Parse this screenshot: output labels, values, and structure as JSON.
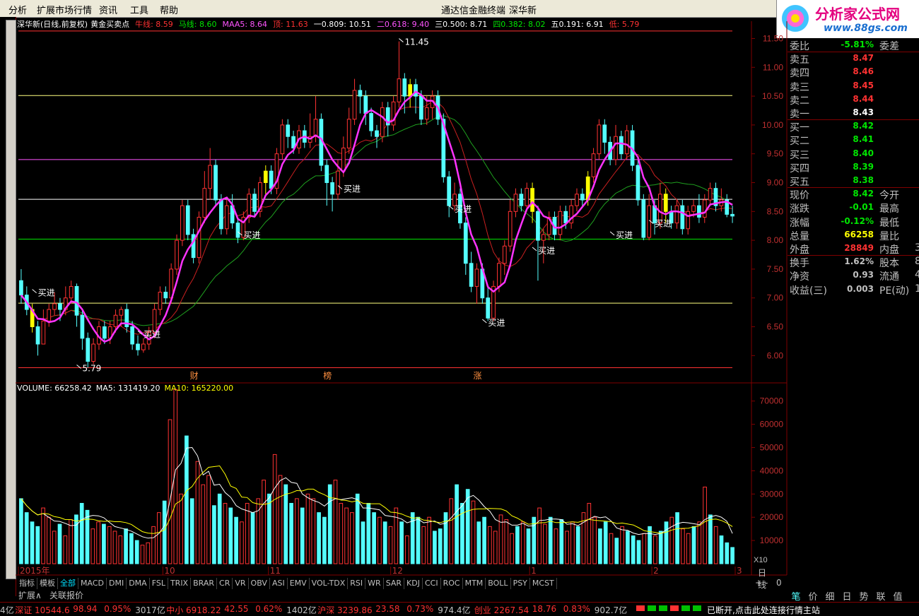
{
  "menu": {
    "items": [
      "分析",
      "扩展市场行情",
      "资讯",
      "工具",
      "帮助"
    ],
    "center_title": "通达信金融终端",
    "stock_title": "深华新"
  },
  "logo": {
    "brand": "分析家公式网",
    "url": "www.88gs.com"
  },
  "chart_header": {
    "title": "深华新(日线,前复权)",
    "indicator": "黄金买卖点",
    "items": [
      {
        "label": "牛线: 8.59",
        "color": "#ff3232"
      },
      {
        "label": "马线: 8.60",
        "color": "#00e600"
      },
      {
        "label": "MAA5: 8.64",
        "color": "#ff54ff"
      },
      {
        "label": "顶: 11.63",
        "color": "#ff3232"
      },
      {
        "label": "一0.809: 10.51",
        "color": "#ffffff"
      },
      {
        "label": "二0.618: 9.40",
        "color": "#ff54ff"
      },
      {
        "label": "三0.500: 8.71",
        "color": "#ffffff"
      },
      {
        "label": "四0.382: 8.02",
        "color": "#00e600"
      },
      {
        "label": "五0.191: 6.91",
        "color": "#ffffff"
      },
      {
        "label": "低: 5.79",
        "color": "#ff3232"
      }
    ]
  },
  "chart_data": [
    {
      "type": "candlestick",
      "title": "深华新(日线,前复权) 黄金买卖点",
      "y_ticks": [
        "11.50",
        "11.00",
        "10.50",
        "10.00",
        "9.50",
        "9.00",
        "8.50",
        "8.00",
        "7.50",
        "7.00",
        "6.50",
        "6.00"
      ],
      "ylim": [
        5.6,
        11.8
      ],
      "x_labels": [
        "2015年",
        "10",
        "11",
        "12",
        "1",
        "2",
        "3"
      ],
      "levels": [
        {
          "name": "顶",
          "value": 11.63,
          "color": "#ff3232"
        },
        {
          "name": "一0.809",
          "value": 10.51,
          "color": "#ffff80"
        },
        {
          "name": "二0.618",
          "value": 9.4,
          "color": "#ff54ff"
        },
        {
          "name": "三0.500",
          "value": 8.71,
          "color": "#ffffff"
        },
        {
          "name": "四0.382",
          "value": 8.02,
          "color": "#00e600"
        },
        {
          "name": "五0.191",
          "value": 6.91,
          "color": "#ffff80"
        },
        {
          "name": "低",
          "value": 5.79,
          "color": "#ff3232"
        }
      ],
      "annotations": [
        {
          "text": "11.45",
          "x": 68,
          "y": 11.45
        },
        {
          "text": "5.79",
          "x": 10,
          "y": 5.79
        },
        {
          "text": "买进",
          "x": 2,
          "y": 7.1
        },
        {
          "text": "买进",
          "x": 21,
          "y": 6.38
        },
        {
          "text": "买进",
          "x": 39,
          "y": 8.1
        },
        {
          "text": "买进",
          "x": 57,
          "y": 8.9
        },
        {
          "text": "买进",
          "x": 77,
          "y": 8.55
        },
        {
          "text": "买进",
          "x": 83,
          "y": 6.58
        },
        {
          "text": "买进",
          "x": 92,
          "y": 7.83
        },
        {
          "text": "买进",
          "x": 106,
          "y": 8.1
        },
        {
          "text": "买进",
          "x": 113,
          "y": 8.3
        }
      ],
      "markers": [
        {
          "text": "财",
          "x": 31
        },
        {
          "text": "榜",
          "x": 55
        },
        {
          "text": "涨",
          "x": 82
        }
      ],
      "candles": [
        [
          7.3,
          7.05,
          7.5,
          6.9
        ],
        [
          7.05,
          6.8,
          7.2,
          6.7
        ],
        [
          6.8,
          6.5,
          6.9,
          6.4
        ],
        [
          6.5,
          6.2,
          6.6,
          6.0
        ],
        [
          6.2,
          6.6,
          6.8,
          6.2
        ],
        [
          6.6,
          6.8,
          6.9,
          6.5
        ],
        [
          6.8,
          6.9,
          7.1,
          6.7
        ],
        [
          6.9,
          6.8,
          7.0,
          6.6
        ],
        [
          6.8,
          7.0,
          7.2,
          6.7
        ],
        [
          7.0,
          7.2,
          7.3,
          6.9
        ],
        [
          7.2,
          6.7,
          7.25,
          6.5
        ],
        [
          6.7,
          6.3,
          6.8,
          6.1
        ],
        [
          6.3,
          5.9,
          6.4,
          5.79
        ],
        [
          5.9,
          6.2,
          6.3,
          5.85
        ],
        [
          6.2,
          6.5,
          6.6,
          6.1
        ],
        [
          6.5,
          6.3,
          6.6,
          6.2
        ],
        [
          6.3,
          6.5,
          6.6,
          6.2
        ],
        [
          6.5,
          6.7,
          6.8,
          6.4
        ],
        [
          6.7,
          6.8,
          6.85,
          6.5
        ],
        [
          6.8,
          6.5,
          6.9,
          6.4
        ],
        [
          6.5,
          6.2,
          6.6,
          6.1
        ],
        [
          6.2,
          6.1,
          6.35,
          6.0
        ],
        [
          6.1,
          6.2,
          6.3,
          6.05
        ],
        [
          6.2,
          6.4,
          6.5,
          6.1
        ],
        [
          6.4,
          6.8,
          6.9,
          6.3
        ],
        [
          6.8,
          7.1,
          7.2,
          6.7
        ],
        [
          7.1,
          7.0,
          7.2,
          6.9
        ],
        [
          7.0,
          7.5,
          7.6,
          6.9
        ],
        [
          7.5,
          8.0,
          8.1,
          7.4
        ],
        [
          8.0,
          8.6,
          8.7,
          7.9
        ],
        [
          8.6,
          8.1,
          8.7,
          8.0
        ],
        [
          8.1,
          7.7,
          8.2,
          7.6
        ],
        [
          7.7,
          8.4,
          8.5,
          7.6
        ],
        [
          8.4,
          8.9,
          9.2,
          8.3
        ],
        [
          8.9,
          9.3,
          9.6,
          8.7
        ],
        [
          9.3,
          8.7,
          9.4,
          8.6
        ],
        [
          8.7,
          8.2,
          8.8,
          8.1
        ],
        [
          8.2,
          8.6,
          8.7,
          8.1
        ],
        [
          8.6,
          8.3,
          8.8,
          8.2
        ],
        [
          8.3,
          8.05,
          8.4,
          7.95
        ],
        [
          8.05,
          8.4,
          8.5,
          8.0
        ],
        [
          8.4,
          8.8,
          8.9,
          8.3
        ],
        [
          8.8,
          8.5,
          8.9,
          8.4
        ],
        [
          8.5,
          9.0,
          9.1,
          8.4
        ],
        [
          9.0,
          9.2,
          9.3,
          8.8
        ],
        [
          9.2,
          8.9,
          9.3,
          8.8
        ],
        [
          8.9,
          9.5,
          9.6,
          8.8
        ],
        [
          9.5,
          10.0,
          10.1,
          9.4
        ],
        [
          10.0,
          9.8,
          10.1,
          9.6
        ],
        [
          9.8,
          9.6,
          9.9,
          9.5
        ],
        [
          9.6,
          9.9,
          10.0,
          9.5
        ],
        [
          9.9,
          9.7,
          10.0,
          9.6
        ],
        [
          9.7,
          9.8,
          10.2,
          9.6
        ],
        [
          9.8,
          10.1,
          10.5,
          9.7
        ],
        [
          10.1,
          9.3,
          10.2,
          9.2
        ],
        [
          9.3,
          9.0,
          9.4,
          8.6
        ],
        [
          9.0,
          8.8,
          9.1,
          8.5
        ],
        [
          8.8,
          9.2,
          9.4,
          8.7
        ],
        [
          9.2,
          9.6,
          9.8,
          9.1
        ],
        [
          9.6,
          10.1,
          10.3,
          9.5
        ],
        [
          10.1,
          10.6,
          10.8,
          10.0
        ],
        [
          10.6,
          10.5,
          10.7,
          10.2
        ],
        [
          10.5,
          10.2,
          10.6,
          10.0
        ],
        [
          10.2,
          9.9,
          10.3,
          9.8
        ],
        [
          9.9,
          9.8,
          10.0,
          9.6
        ],
        [
          9.8,
          10.3,
          10.4,
          9.7
        ],
        [
          10.3,
          10.0,
          10.4,
          9.8
        ],
        [
          10.0,
          10.4,
          10.5,
          9.9
        ],
        [
          10.4,
          10.8,
          11.45,
          10.3
        ],
        [
          10.8,
          10.5,
          10.9,
          10.2
        ],
        [
          10.5,
          10.7,
          10.8,
          10.3
        ],
        [
          10.7,
          10.5,
          10.8,
          10.2
        ],
        [
          10.5,
          10.1,
          10.6,
          10.0
        ],
        [
          10.1,
          10.3,
          10.5,
          10.0
        ],
        [
          10.3,
          10.5,
          10.6,
          10.1
        ],
        [
          10.5,
          10.1,
          10.6,
          10.0
        ],
        [
          10.1,
          9.1,
          10.2,
          9.0
        ],
        [
          9.1,
          8.6,
          9.2,
          8.4
        ],
        [
          8.6,
          8.8,
          9.0,
          8.5
        ],
        [
          8.8,
          8.3,
          8.9,
          8.2
        ],
        [
          8.3,
          7.6,
          8.4,
          7.4
        ],
        [
          7.6,
          7.2,
          7.8,
          7.1
        ],
        [
          7.2,
          7.5,
          7.6,
          6.9
        ],
        [
          7.5,
          7.0,
          7.6,
          6.9
        ],
        [
          7.0,
          6.65,
          7.2,
          6.6
        ],
        [
          6.65,
          7.2,
          7.3,
          6.6
        ],
        [
          7.2,
          7.6,
          7.7,
          7.1
        ],
        [
          7.6,
          7.9,
          8.0,
          7.4
        ],
        [
          7.9,
          8.5,
          8.7,
          7.8
        ],
        [
          8.5,
          8.8,
          8.9,
          8.4
        ],
        [
          8.8,
          8.6,
          8.9,
          8.5
        ],
        [
          8.6,
          8.9,
          9.0,
          8.5
        ],
        [
          8.9,
          8.5,
          9.0,
          8.3
        ],
        [
          8.5,
          8.0,
          8.6,
          7.3
        ],
        [
          8.0,
          8.1,
          8.2,
          7.6
        ],
        [
          8.1,
          8.4,
          8.5,
          8.0
        ],
        [
          8.4,
          8.1,
          8.5,
          8.0
        ],
        [
          8.1,
          8.5,
          8.6,
          8.0
        ],
        [
          8.5,
          8.3,
          8.6,
          8.2
        ],
        [
          8.3,
          8.6,
          8.7,
          8.2
        ],
        [
          8.6,
          8.8,
          8.9,
          8.5
        ],
        [
          8.8,
          8.7,
          8.9,
          8.6
        ],
        [
          8.7,
          9.1,
          9.2,
          8.6
        ],
        [
          9.1,
          9.5,
          9.6,
          9.0
        ],
        [
          9.5,
          10.0,
          10.1,
          9.4
        ],
        [
          10.0,
          9.7,
          10.1,
          9.5
        ],
        [
          9.7,
          9.4,
          9.8,
          9.3
        ],
        [
          9.4,
          9.8,
          10.0,
          9.3
        ],
        [
          9.8,
          9.5,
          9.9,
          9.4
        ],
        [
          9.5,
          9.9,
          10.0,
          9.4
        ],
        [
          9.9,
          9.3,
          10.0,
          9.2
        ],
        [
          9.3,
          8.7,
          9.4,
          8.6
        ],
        [
          8.7,
          8.05,
          8.8,
          8.0
        ],
        [
          8.05,
          8.6,
          8.8,
          8.0
        ],
        [
          8.6,
          8.3,
          8.7,
          8.1
        ],
        [
          8.3,
          8.8,
          9.0,
          8.2
        ],
        [
          8.8,
          8.5,
          8.9,
          8.3
        ],
        [
          8.5,
          8.3,
          8.6,
          8.2
        ],
        [
          8.3,
          8.6,
          8.7,
          8.2
        ],
        [
          8.6,
          8.2,
          8.7,
          8.1
        ],
        [
          8.2,
          8.5,
          8.6,
          8.1
        ],
        [
          8.5,
          8.6,
          8.7,
          8.4
        ],
        [
          8.6,
          8.4,
          8.8,
          8.3
        ],
        [
          8.4,
          8.7,
          8.8,
          8.3
        ],
        [
          8.7,
          8.9,
          9.0,
          8.6
        ],
        [
          8.9,
          8.6,
          9.0,
          8.5
        ],
        [
          8.6,
          8.7,
          8.9,
          8.5
        ],
        [
          8.7,
          8.45,
          8.8,
          8.4
        ],
        [
          8.45,
          8.42,
          8.6,
          8.3
        ]
      ],
      "buy_bars": [
        2,
        44,
        70,
        92,
        102,
        116
      ],
      "ma": {
        "maa5": "#ff33ff",
        "niu": "#c82020",
        "ma": "#1fa01f"
      }
    },
    {
      "type": "bar",
      "title": "VOLUME",
      "y_ticks": [
        "70000",
        "60000",
        "50000",
        "40000",
        "30000",
        "20000",
        "10000"
      ],
      "ylim": [
        0,
        76000
      ],
      "unit_label": "X10",
      "volumes": [
        28000,
        22000,
        18000,
        16000,
        24000,
        20000,
        14000,
        17000,
        12000,
        19000,
        21000,
        26000,
        23000,
        15000,
        18000,
        17000,
        16000,
        14000,
        12000,
        15000,
        13000,
        10000,
        8000,
        9000,
        16000,
        22000,
        27000,
        62000,
        75000,
        30000,
        55000,
        28000,
        44000,
        34000,
        38000,
        25000,
        30000,
        26000,
        24000,
        20000,
        18000,
        26000,
        22000,
        28000,
        36000,
        30000,
        47000,
        38000,
        34000,
        26000,
        28000,
        24000,
        30000,
        28000,
        22000,
        20000,
        34000,
        36000,
        26000,
        24000,
        22000,
        30000,
        18000,
        26000,
        22000,
        20000,
        18000,
        16000,
        24000,
        18000,
        12000,
        22000,
        20000,
        16000,
        20000,
        14000,
        15000,
        22000,
        28000,
        34000,
        26000,
        32000,
        27000,
        18000,
        20000,
        16000,
        14000,
        21000,
        19000,
        13000,
        16000,
        18000,
        15000,
        20000,
        24000,
        17000,
        20000,
        15000,
        19000,
        14000,
        18000,
        16000,
        22000,
        26000,
        20000,
        15000,
        18000,
        13000,
        11000,
        16000,
        14000,
        12000,
        10000,
        13000,
        16000,
        12000,
        14000,
        18000,
        20000,
        22000,
        15000,
        13000,
        16000,
        18000,
        33000,
        21000,
        16000,
        12000,
        9000,
        7000
      ],
      "ma5": "#ffffff",
      "ma10": "#ffff00"
    }
  ],
  "vol_header": [
    {
      "label": "VOLUME: 66258.42",
      "color": "#ffffff"
    },
    {
      "label": "MA5: 131419.20",
      "color": "#ffffff"
    },
    {
      "label": "MA10: 165220.00",
      "color": "#ffff00"
    }
  ],
  "quote": {
    "rows": [
      {
        "l": "委比",
        "v": "-5.81%",
        "vc": "#00e600",
        "l2": "委差",
        "v2": ""
      },
      {
        "l": "卖五",
        "v": "8.47",
        "vc": "#ff3232"
      },
      {
        "l": "卖四",
        "v": "8.46",
        "vc": "#ff3232"
      },
      {
        "l": "卖三",
        "v": "8.45",
        "vc": "#ff3232"
      },
      {
        "l": "卖二",
        "v": "8.44",
        "vc": "#ff3232"
      },
      {
        "l": "卖一",
        "v": "8.43",
        "vc": "#ffffff"
      },
      {
        "l": "买一",
        "v": "8.42",
        "vc": "#00e600"
      },
      {
        "l": "买二",
        "v": "8.41",
        "vc": "#00e600"
      },
      {
        "l": "买三",
        "v": "8.40",
        "vc": "#00e600"
      },
      {
        "l": "买四",
        "v": "8.39",
        "vc": "#00e600"
      },
      {
        "l": "买五",
        "v": "8.38",
        "vc": "#00e600"
      },
      {
        "l": "现价",
        "v": "8.42",
        "vc": "#00e600",
        "l2": "今开",
        "v2": ""
      },
      {
        "l": "涨跌",
        "v": "-0.01",
        "vc": "#00e600",
        "l2": "最高",
        "v2": ""
      },
      {
        "l": "涨幅",
        "v": "-0.12%",
        "vc": "#00e600",
        "l2": "最低",
        "v2": ""
      },
      {
        "l": "总量",
        "v": "66258",
        "vc": "#ffff00",
        "l2": "量比",
        "v2": ""
      },
      {
        "l": "外盘",
        "v": "28849",
        "vc": "#ff3232",
        "l2": "内盘",
        "v2": "3"
      },
      {
        "l": "换手",
        "v": "1.62%",
        "vc": "#c0c0c0",
        "l2": "股本",
        "v2": "8"
      },
      {
        "l": "净资",
        "v": "0.93",
        "vc": "#c0c0c0",
        "l2": "流通",
        "v2": "4"
      },
      {
        "l": "收益(三)",
        "v": "0.003",
        "vc": "#c0c0c0",
        "l2": "PE(动)",
        "v2": "1"
      }
    ]
  },
  "tabs": [
    "指标",
    "模板",
    "全部",
    "MACD",
    "DMI",
    "DMA",
    "FSL",
    "TRIX",
    "BRAR",
    "CR",
    "VR",
    "OBV",
    "ASI",
    "EMV",
    "VOL-TDX",
    "RSI",
    "WR",
    "SAR",
    "KDJ",
    "CCI",
    "ROC",
    "MTM",
    "BOLL",
    "PSY",
    "MCST"
  ],
  "active_tab": "全部",
  "ext_bar": {
    "expand": "扩展∧",
    "related": "关联报价",
    "period": "日线",
    "zoom": [
      "+",
      "-",
      "0"
    ]
  },
  "right_buttons": [
    "笔",
    "价",
    "细",
    "日",
    "势",
    "联",
    "值"
  ],
  "status": {
    "items": [
      {
        "name": "深证",
        "val": "10544.6",
        "chg": "98.94",
        "pct": "0.95%",
        "amt": "3017亿"
      },
      {
        "name": "中小",
        "val": "6918.22",
        "chg": "42.55",
        "pct": "0.62%",
        "amt": "1402亿"
      },
      {
        "name": "沪深",
        "val": "3239.86",
        "chg": "23.58",
        "pct": "0.73%",
        "amt": "974.4亿"
      },
      {
        "name": "创业",
        "val": "2267.54",
        "chg": "18.76",
        "pct": "0.83%",
        "amt": "902.7亿"
      }
    ],
    "prefix": "4亿",
    "conn": "已断开,点击此处连接行情主站"
  }
}
